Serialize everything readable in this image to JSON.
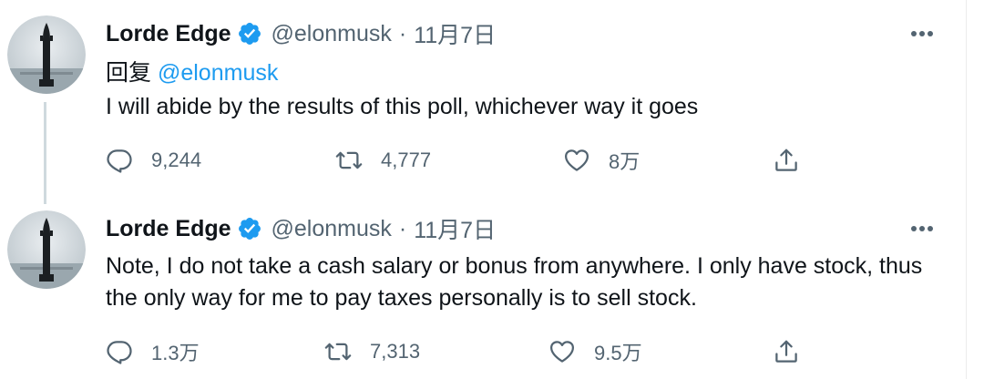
{
  "tweets": [
    {
      "name": "Lorde Edge",
      "handle": "@elonmusk",
      "separator": "·",
      "date": "11月7日",
      "replying_prefix": "回复",
      "replying_to": "@elonmusk",
      "text": "I will abide by the results of this poll, whichever way it goes",
      "replies": "9,244",
      "retweets": "4,777",
      "likes": "8万"
    },
    {
      "name": "Lorde Edge",
      "handle": "@elonmusk",
      "separator": "·",
      "date": "11月7日",
      "text": "Note, I do not take a cash salary or bonus from anywhere. I only have stock, thus the only way for me to pay taxes personally is to sell stock.",
      "replies": "1.3万",
      "retweets": "7,313",
      "likes": "9.5万"
    }
  ],
  "icons": {
    "verified": "verified-badge-icon",
    "more": "more-horizontal-icon",
    "reply": "reply-icon",
    "retweet": "retweet-icon",
    "like": "like-icon",
    "share": "share-icon"
  },
  "colors": {
    "accent": "#1d9bf0",
    "secondary_text": "#536471",
    "thread_line": "#cfd9de"
  }
}
